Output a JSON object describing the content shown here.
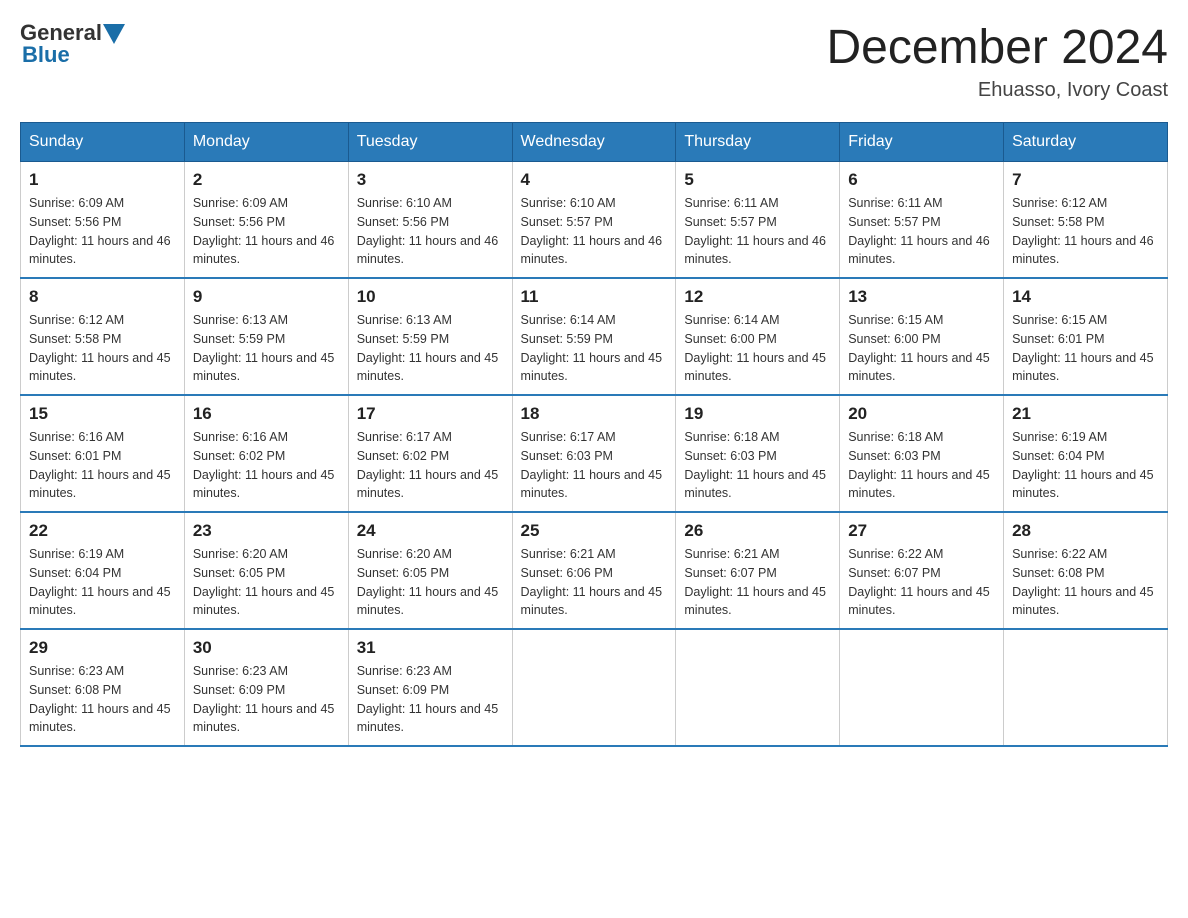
{
  "header": {
    "logo": {
      "general": "General",
      "blue": "Blue"
    },
    "title": "December 2024",
    "location": "Ehuasso, Ivory Coast"
  },
  "weekdays": [
    "Sunday",
    "Monday",
    "Tuesday",
    "Wednesday",
    "Thursday",
    "Friday",
    "Saturday"
  ],
  "weeks": [
    [
      {
        "day": "1",
        "sunrise": "6:09 AM",
        "sunset": "5:56 PM",
        "daylight": "11 hours and 46 minutes."
      },
      {
        "day": "2",
        "sunrise": "6:09 AM",
        "sunset": "5:56 PM",
        "daylight": "11 hours and 46 minutes."
      },
      {
        "day": "3",
        "sunrise": "6:10 AM",
        "sunset": "5:56 PM",
        "daylight": "11 hours and 46 minutes."
      },
      {
        "day": "4",
        "sunrise": "6:10 AM",
        "sunset": "5:57 PM",
        "daylight": "11 hours and 46 minutes."
      },
      {
        "day": "5",
        "sunrise": "6:11 AM",
        "sunset": "5:57 PM",
        "daylight": "11 hours and 46 minutes."
      },
      {
        "day": "6",
        "sunrise": "6:11 AM",
        "sunset": "5:57 PM",
        "daylight": "11 hours and 46 minutes."
      },
      {
        "day": "7",
        "sunrise": "6:12 AM",
        "sunset": "5:58 PM",
        "daylight": "11 hours and 46 minutes."
      }
    ],
    [
      {
        "day": "8",
        "sunrise": "6:12 AM",
        "sunset": "5:58 PM",
        "daylight": "11 hours and 45 minutes."
      },
      {
        "day": "9",
        "sunrise": "6:13 AM",
        "sunset": "5:59 PM",
        "daylight": "11 hours and 45 minutes."
      },
      {
        "day": "10",
        "sunrise": "6:13 AM",
        "sunset": "5:59 PM",
        "daylight": "11 hours and 45 minutes."
      },
      {
        "day": "11",
        "sunrise": "6:14 AM",
        "sunset": "5:59 PM",
        "daylight": "11 hours and 45 minutes."
      },
      {
        "day": "12",
        "sunrise": "6:14 AM",
        "sunset": "6:00 PM",
        "daylight": "11 hours and 45 minutes."
      },
      {
        "day": "13",
        "sunrise": "6:15 AM",
        "sunset": "6:00 PM",
        "daylight": "11 hours and 45 minutes."
      },
      {
        "day": "14",
        "sunrise": "6:15 AM",
        "sunset": "6:01 PM",
        "daylight": "11 hours and 45 minutes."
      }
    ],
    [
      {
        "day": "15",
        "sunrise": "6:16 AM",
        "sunset": "6:01 PM",
        "daylight": "11 hours and 45 minutes."
      },
      {
        "day": "16",
        "sunrise": "6:16 AM",
        "sunset": "6:02 PM",
        "daylight": "11 hours and 45 minutes."
      },
      {
        "day": "17",
        "sunrise": "6:17 AM",
        "sunset": "6:02 PM",
        "daylight": "11 hours and 45 minutes."
      },
      {
        "day": "18",
        "sunrise": "6:17 AM",
        "sunset": "6:03 PM",
        "daylight": "11 hours and 45 minutes."
      },
      {
        "day": "19",
        "sunrise": "6:18 AM",
        "sunset": "6:03 PM",
        "daylight": "11 hours and 45 minutes."
      },
      {
        "day": "20",
        "sunrise": "6:18 AM",
        "sunset": "6:03 PM",
        "daylight": "11 hours and 45 minutes."
      },
      {
        "day": "21",
        "sunrise": "6:19 AM",
        "sunset": "6:04 PM",
        "daylight": "11 hours and 45 minutes."
      }
    ],
    [
      {
        "day": "22",
        "sunrise": "6:19 AM",
        "sunset": "6:04 PM",
        "daylight": "11 hours and 45 minutes."
      },
      {
        "day": "23",
        "sunrise": "6:20 AM",
        "sunset": "6:05 PM",
        "daylight": "11 hours and 45 minutes."
      },
      {
        "day": "24",
        "sunrise": "6:20 AM",
        "sunset": "6:05 PM",
        "daylight": "11 hours and 45 minutes."
      },
      {
        "day": "25",
        "sunrise": "6:21 AM",
        "sunset": "6:06 PM",
        "daylight": "11 hours and 45 minutes."
      },
      {
        "day": "26",
        "sunrise": "6:21 AM",
        "sunset": "6:07 PM",
        "daylight": "11 hours and 45 minutes."
      },
      {
        "day": "27",
        "sunrise": "6:22 AM",
        "sunset": "6:07 PM",
        "daylight": "11 hours and 45 minutes."
      },
      {
        "day": "28",
        "sunrise": "6:22 AM",
        "sunset": "6:08 PM",
        "daylight": "11 hours and 45 minutes."
      }
    ],
    [
      {
        "day": "29",
        "sunrise": "6:23 AM",
        "sunset": "6:08 PM",
        "daylight": "11 hours and 45 minutes."
      },
      {
        "day": "30",
        "sunrise": "6:23 AM",
        "sunset": "6:09 PM",
        "daylight": "11 hours and 45 minutes."
      },
      {
        "day": "31",
        "sunrise": "6:23 AM",
        "sunset": "6:09 PM",
        "daylight": "11 hours and 45 minutes."
      },
      null,
      null,
      null,
      null
    ]
  ]
}
